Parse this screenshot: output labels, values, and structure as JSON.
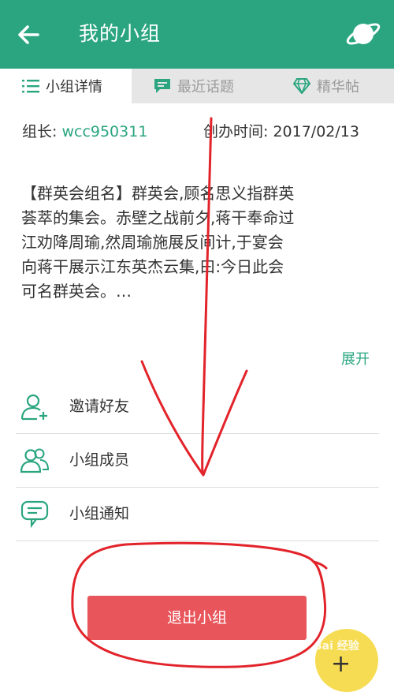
{
  "appbar": {
    "title": "我的小组",
    "back_icon": "arrow-left-icon",
    "planet_icon": "planet-icon"
  },
  "tabs": [
    {
      "label": "小组详情",
      "icon": "list-icon",
      "active": true
    },
    {
      "label": "最近话题",
      "icon": "chat-bubble-icon",
      "active": false
    },
    {
      "label": "精华帖",
      "icon": "diamond-icon",
      "active": false
    }
  ],
  "meta": {
    "leader_label": "组长:",
    "leader_value": "wcc950311",
    "created_label": "创办时间:",
    "created_value": "2017/02/13"
  },
  "description": {
    "lines": [
      "【群英会组名】群英会,顾名思义指群英",
      "荟萃的集会。赤壁之战前夕,蒋干奉命过",
      "江劝降周瑜,然周瑜施展反间计,于宴会",
      "向蒋干展示江东英杰云集,曰:今日此会",
      "可名群英会。…"
    ],
    "expand_label": "展开"
  },
  "menu": [
    {
      "label": "邀请好友",
      "icon": "add-user-icon"
    },
    {
      "label": "小组成员",
      "icon": "members-icon"
    },
    {
      "label": "小组通知",
      "icon": "notice-icon"
    }
  ],
  "leave_button": "退出小组",
  "watermark": "Bai 经验",
  "colors": {
    "primary": "#2aa57f",
    "danger": "#e8555b",
    "tab_bg": "#e6e6e6",
    "annotation": "#e2232a"
  }
}
